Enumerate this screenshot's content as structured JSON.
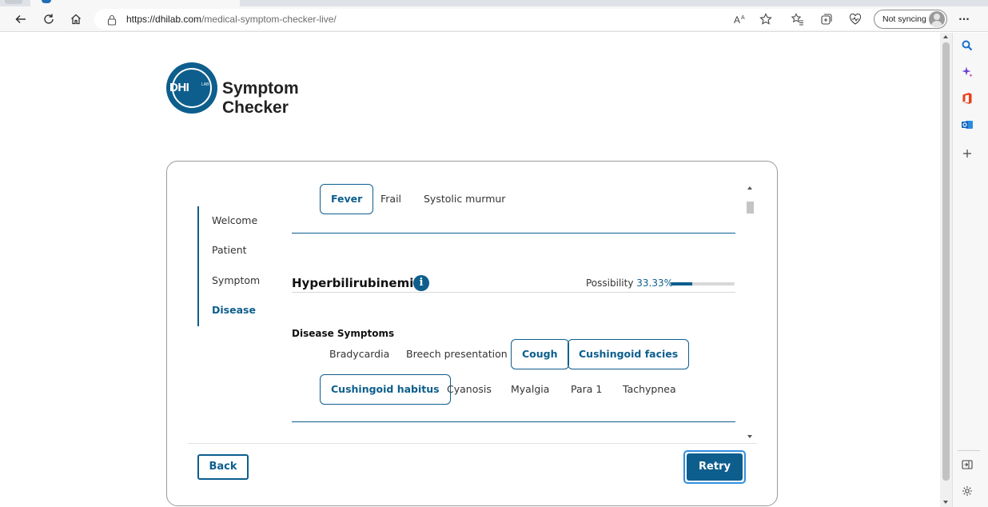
{
  "browser": {
    "url_host": "https://dhilab.com",
    "url_path": "/medical-symptom-checker-live/",
    "sync_label": "Not syncing",
    "menu_label": "···"
  },
  "brand": {
    "logo_text": "DHI",
    "logo_sub": "LAB",
    "line1": "Symptom",
    "line2": "Checker"
  },
  "steps": [
    {
      "label": "Welcome",
      "active": false
    },
    {
      "label": "Patient",
      "active": false
    },
    {
      "label": "Symptom",
      "active": false
    },
    {
      "label": "Disease",
      "active": true
    }
  ],
  "top_symptoms": [
    {
      "label": "Fever",
      "selected": true
    },
    {
      "label": "Frail",
      "selected": false
    },
    {
      "label": "Systolic murmur",
      "selected": false
    }
  ],
  "disease": {
    "name": "Hyperbilirubinemia",
    "info_icon": "i",
    "possibility_label": "Possibility",
    "possibility_value": "33.33%",
    "possibility_fraction": 0.3333
  },
  "disease_symptoms_heading": "Disease Symptoms",
  "disease_symptoms": [
    {
      "label": "Bradycardia",
      "selected": false
    },
    {
      "label": "Breech presentation",
      "selected": false
    },
    {
      "label": "Cough",
      "selected": true
    },
    {
      "label": "Cushingoid facies",
      "selected": true
    },
    {
      "label": "Cushingoid habitus",
      "selected": true
    },
    {
      "label": "Cyanosis",
      "selected": false
    },
    {
      "label": "Myalgia",
      "selected": false
    },
    {
      "label": "Para 1",
      "selected": false
    },
    {
      "label": "Tachypnea",
      "selected": false
    }
  ],
  "buttons": {
    "back": "Back",
    "retry": "Retry"
  },
  "colors": {
    "accent": "#0d5e8d",
    "focus_ring": "#2f8fe0"
  }
}
